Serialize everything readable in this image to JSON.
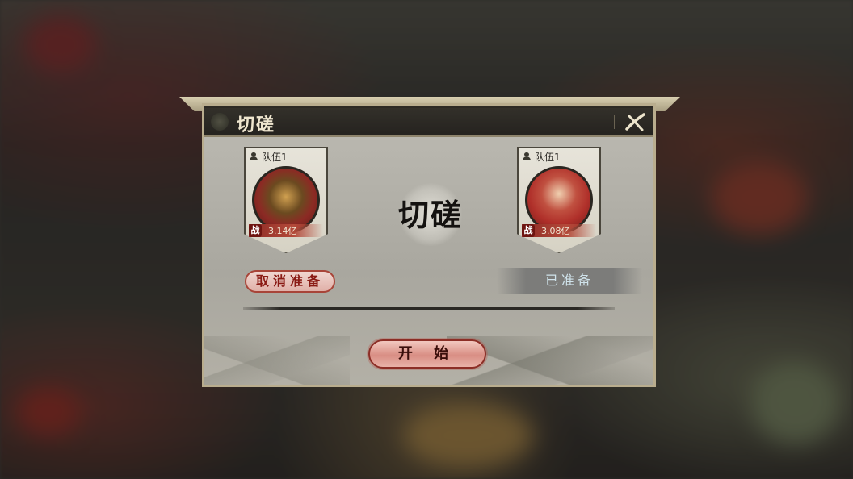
{
  "dialog": {
    "title": "切磋",
    "close_icon": "close-x-icon",
    "center_text": "切磋",
    "start_label": "开 始"
  },
  "teams": [
    {
      "label": "队伍1",
      "power_badge": "战",
      "power": "3.14亿",
      "action_label": "取消准备",
      "avatar": "warrior-portrait"
    },
    {
      "label": "队伍1",
      "power_badge": "战",
      "power": "3.08亿",
      "status_label": "已准备",
      "avatar": "lady-portrait"
    }
  ],
  "colors": {
    "accent_red": "#8c2e26",
    "ready_text": "#cfe2ea",
    "frame": "#b9ad8e"
  }
}
